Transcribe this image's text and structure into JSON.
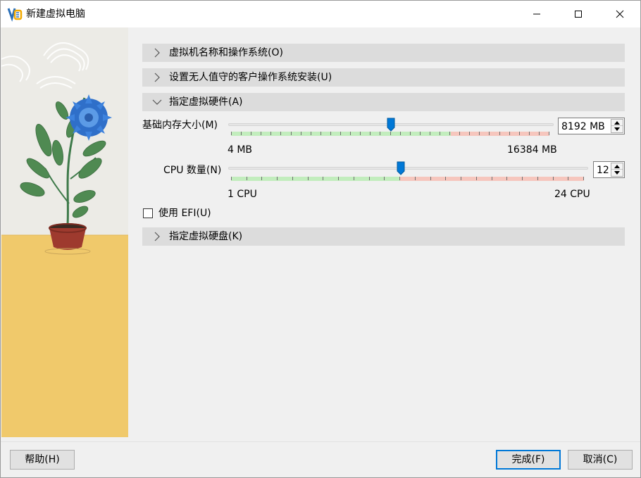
{
  "window": {
    "title": "新建虚拟电脑",
    "app_icon": "virtualbox-logo-icon",
    "controls": [
      "minimize-icon",
      "maximize-icon",
      "close-icon"
    ]
  },
  "sections": [
    {
      "label": "虚拟机名称和操作系统(O)",
      "expanded": false
    },
    {
      "label": "设置无人值守的客户操作系统安装(U)",
      "expanded": false
    },
    {
      "label": "指定虚拟硬件(A)",
      "expanded": true
    },
    {
      "label": "指定虚拟硬盘(K)",
      "expanded": false
    }
  ],
  "hardware": {
    "memory": {
      "label": "基础内存大小(M)",
      "min_label": "4 MB",
      "max_label": "16384 MB",
      "value": "8192 MB",
      "value_number": 8192,
      "min": 4,
      "max": 16384,
      "recommended_fraction": 0.69
    },
    "cpu": {
      "label": "CPU 数量(N)",
      "min_label": "1 CPU",
      "max_label": "24 CPU",
      "value": "12",
      "value_number": 12,
      "min": 1,
      "max": 24,
      "recommended_fraction": 0.48
    },
    "efi": {
      "label": "使用 EFI(U)",
      "checked": false
    }
  },
  "buttons": {
    "help": "帮助(H)",
    "finish": "完成(F)",
    "cancel": "取消(C)"
  },
  "colors": {
    "accent": "#0078d7",
    "section_bg": "#dcdcdc",
    "green_band": "#c2edbd",
    "red_band": "#f6c6bd",
    "art_wall": "#ecebe6",
    "art_floor": "#f0c96b"
  }
}
